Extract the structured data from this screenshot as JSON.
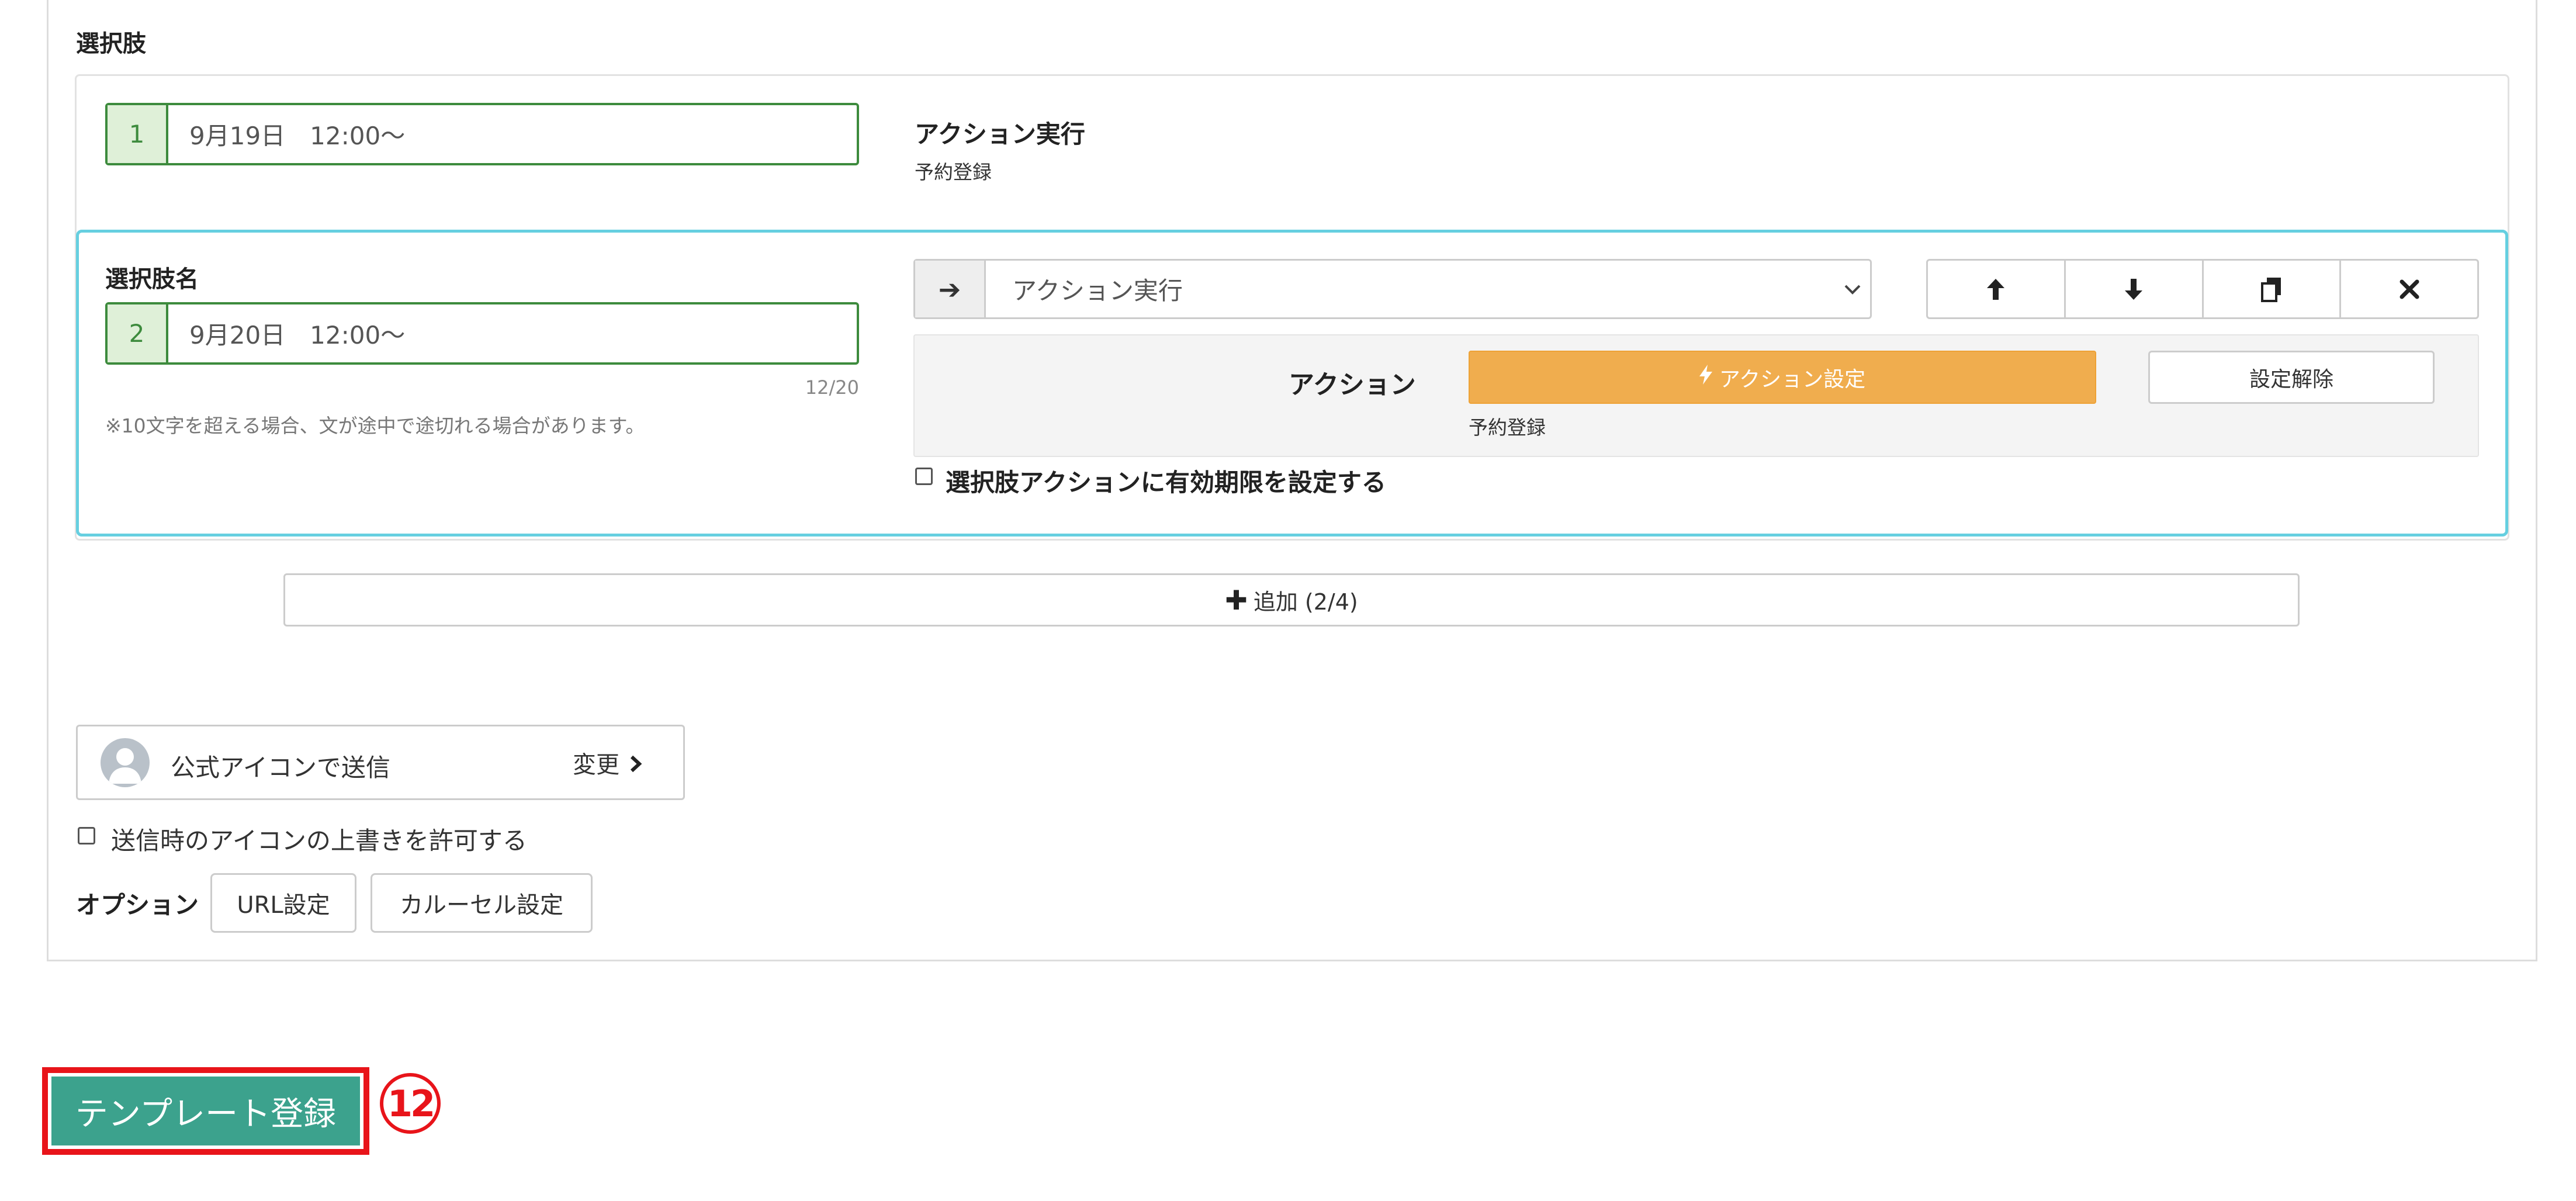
{
  "section_title": "選択肢",
  "choices": [
    {
      "number": "1",
      "text": "9月19日　12:00～",
      "action_title": "アクション実行",
      "action_sub": "予約登録"
    },
    {
      "name_label": "選択肢名",
      "number": "2",
      "text": "9月20日　12:00～",
      "char_count": "12/20",
      "note": "※10文字を超える場合、文が途中で途切れる場合があります。",
      "action_select": {
        "arrow_icon": "arrow-right-icon",
        "value": "アクション実行"
      },
      "move_buttons": [
        {
          "icon": "arrow-up-icon",
          "glyph": "🡅"
        },
        {
          "icon": "arrow-down-icon",
          "glyph": "🡇"
        },
        {
          "icon": "copy-icon",
          "glyph": "⎘"
        },
        {
          "icon": "close-icon",
          "glyph": "✖"
        }
      ],
      "action_panel": {
        "label": "アクション",
        "setting_button": "アクション設定",
        "setting_button_icon": "bolt-icon",
        "sub_label": "予約登録",
        "clear_button": "設定解除"
      },
      "expiry_checkbox_label": "選択肢アクションに有効期限を設定する"
    }
  ],
  "add_button": {
    "label": "追加 (2/4)",
    "icon": "plus-icon"
  },
  "sender": {
    "label": "公式アイコンで送信",
    "change_label": "変更"
  },
  "override_checkbox_label": "送信時のアイコンの上書きを許可する",
  "options": {
    "label": "オプション",
    "url_button": "URL設定",
    "carousel_button": "カルーセル設定"
  },
  "submit": {
    "label": "テンプレート登録",
    "step_marker": "12"
  },
  "colors": {
    "accent_green": "#3d8b3d",
    "focus_border": "#66cfe0",
    "warning_orange": "#f0ad4e",
    "submit_teal": "#3ca28d",
    "highlight_red": "#e8141a"
  }
}
